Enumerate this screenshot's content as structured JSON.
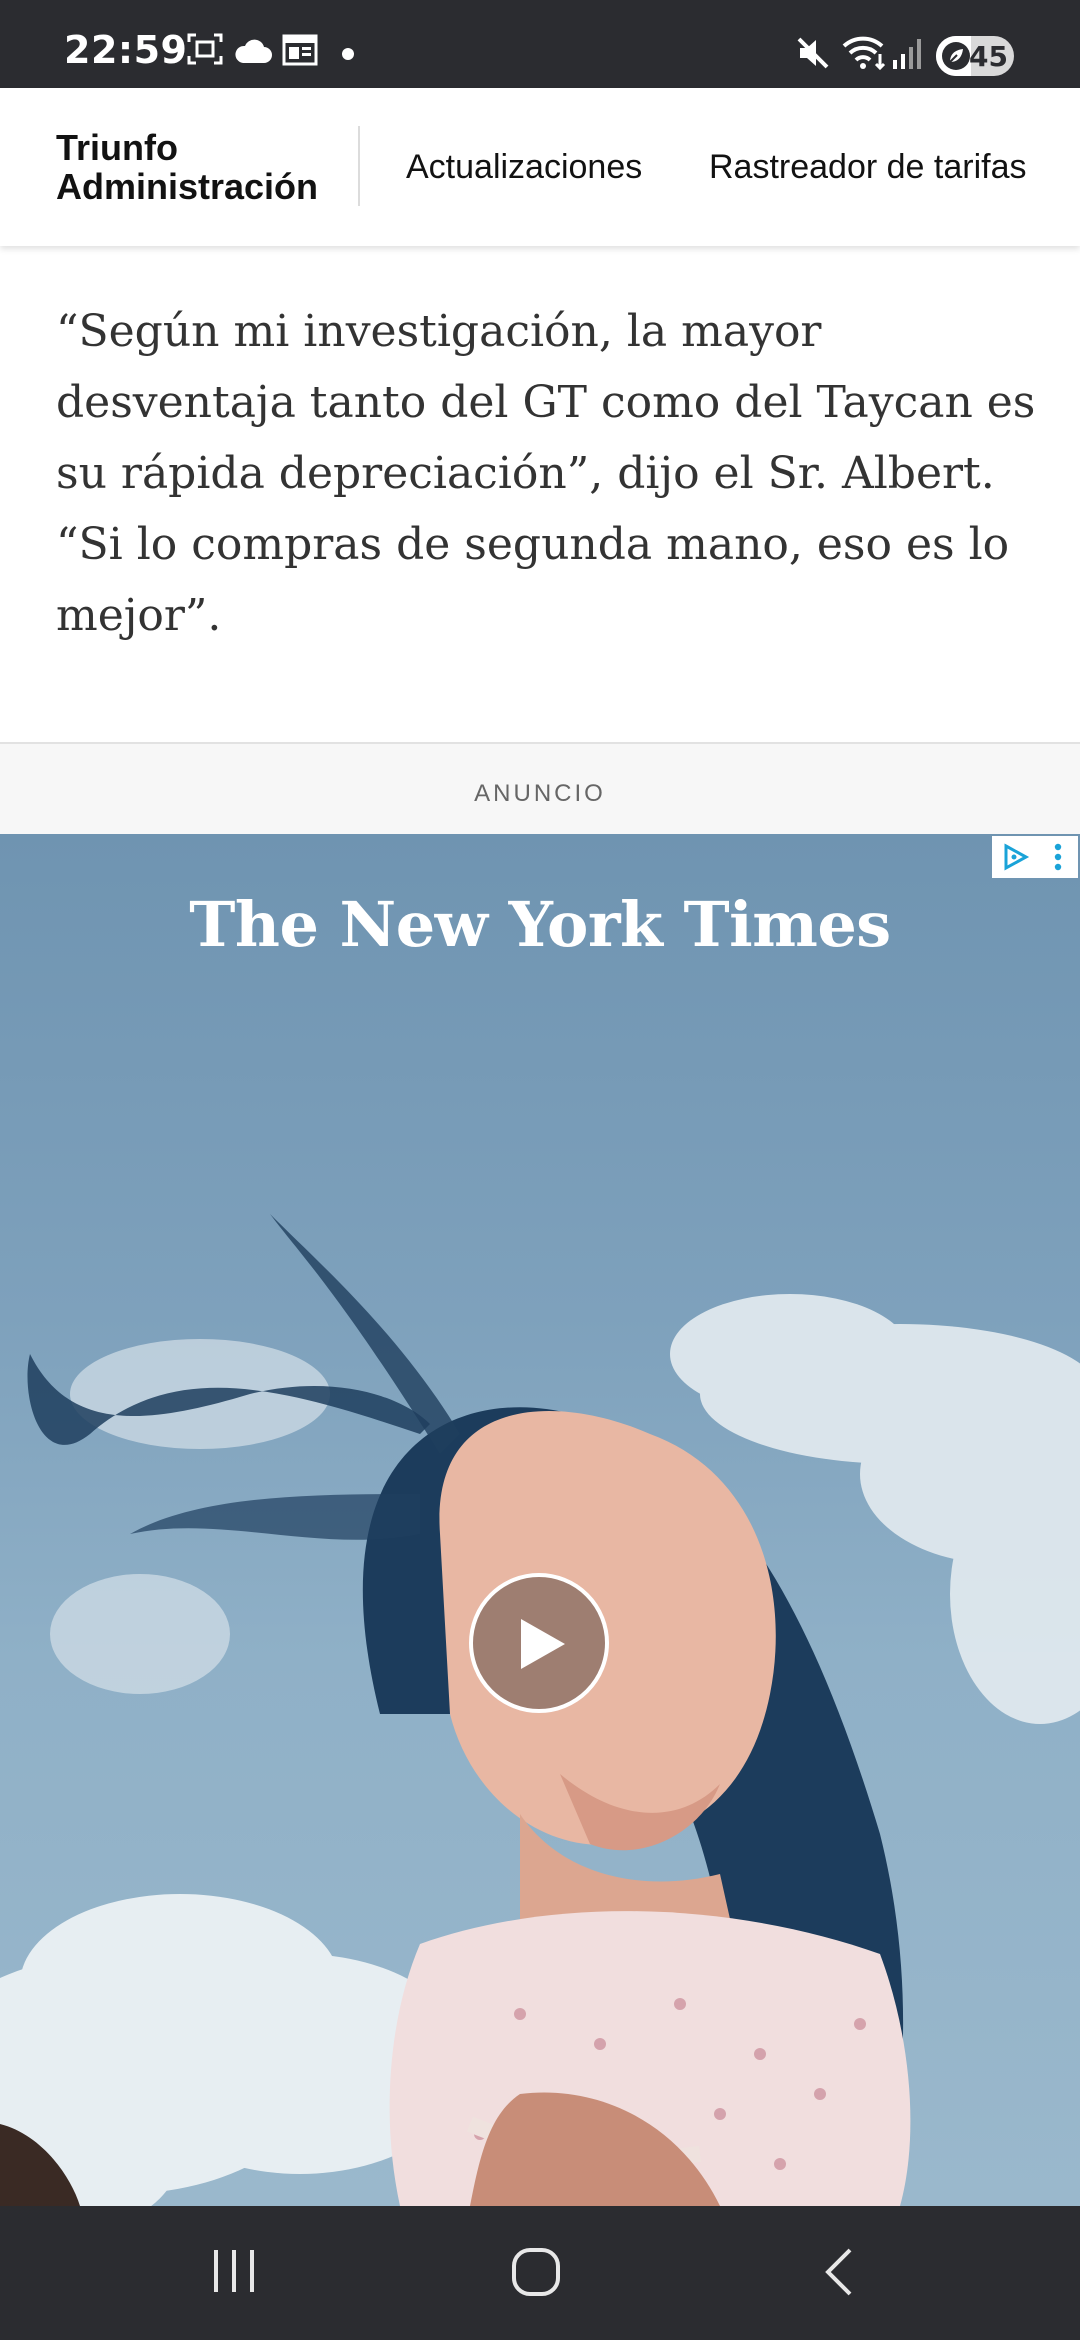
{
  "status_bar": {
    "time": "22:59",
    "battery": "45",
    "battery_level": 0.45,
    "left_icons": [
      "screenshot-icon",
      "cloud-icon",
      "calendar-icon",
      "dot-icon"
    ],
    "right_icons": [
      "mute-icon",
      "wifi-icon",
      "signal-icon",
      "battery-icon"
    ]
  },
  "header": {
    "section_title_line1": "Triunfo",
    "section_title_line2": "Administración",
    "nav_links": [
      "Actualizaciones",
      "Rastreador de tarifas"
    ]
  },
  "article": {
    "quote": "“Según mi investigación, la mayor desventaja tanto del GT como del Taycan es su rápida depreciación”, dijo el Sr. Albert. “Si lo compras de segunda mano, eso es lo mejor”."
  },
  "ad": {
    "label": "ANUNCIO",
    "brand": "The New York Times",
    "play_icon": "play-icon",
    "adchoices_icon": "adchoices-icon",
    "more_icon": "more-vert-icon"
  },
  "nav_bar": {
    "icons": [
      "recent-apps-icon",
      "home-icon",
      "back-icon"
    ]
  }
}
